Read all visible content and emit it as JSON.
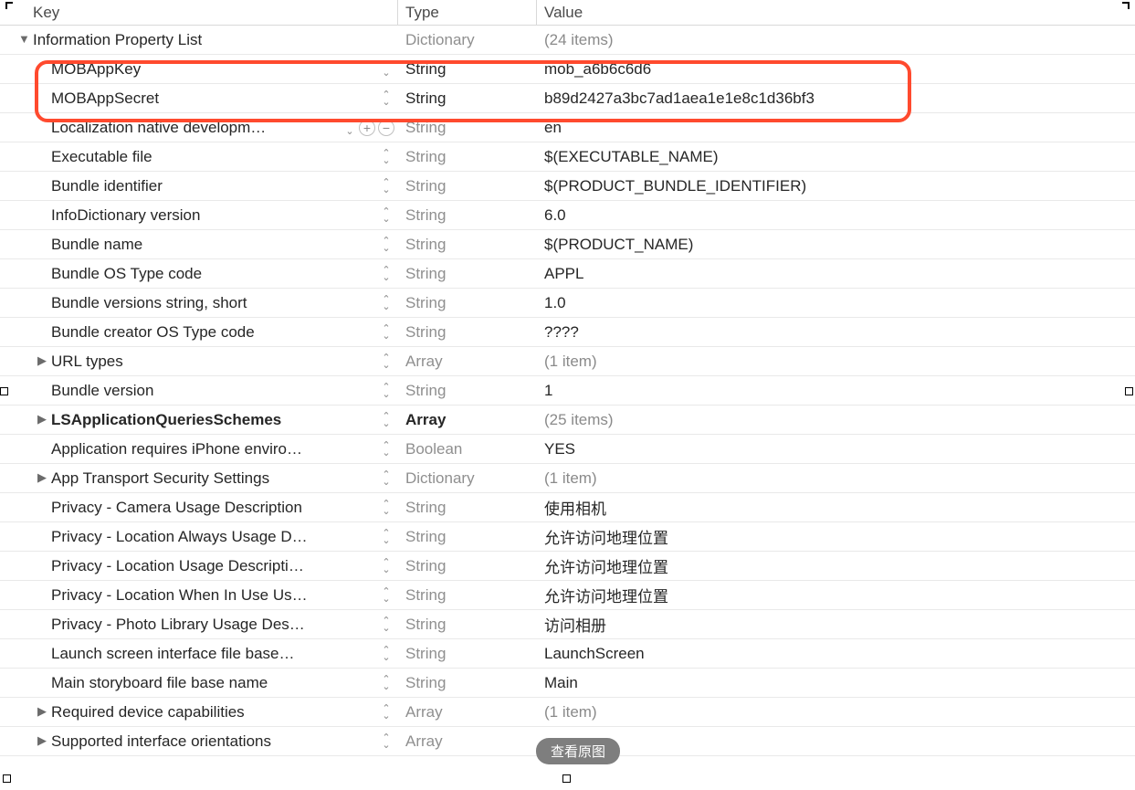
{
  "columns": {
    "key": "Key",
    "type": "Type",
    "value": "Value"
  },
  "root": {
    "key": "Information Property List",
    "type": "Dictionary",
    "value": "(24 items)"
  },
  "rows": [
    {
      "key": "MOBAppKey",
      "type": "String",
      "value": "mob_a6b6c6d6",
      "typeClass": "black",
      "valueClass": "black",
      "stepper": true
    },
    {
      "key": "MOBAppSecret",
      "type": "String",
      "value": "b89d2427a3bc7ad1aea1e1e8c1d36bf3",
      "typeClass": "black",
      "valueClass": "black",
      "stepper": true
    },
    {
      "key": "Localization native developm…",
      "type": "String",
      "value": "en",
      "typeClass": "gray",
      "valueClass": "black",
      "addremove": true
    },
    {
      "key": "Executable file",
      "type": "String",
      "value": "$(EXECUTABLE_NAME)",
      "typeClass": "gray",
      "valueClass": "black",
      "stepper": true
    },
    {
      "key": "Bundle identifier",
      "type": "String",
      "value": "$(PRODUCT_BUNDLE_IDENTIFIER)",
      "typeClass": "gray",
      "valueClass": "black",
      "stepper": true
    },
    {
      "key": "InfoDictionary version",
      "type": "String",
      "value": "6.0",
      "typeClass": "gray",
      "valueClass": "black",
      "stepper": true
    },
    {
      "key": "Bundle name",
      "type": "String",
      "value": "$(PRODUCT_NAME)",
      "typeClass": "gray",
      "valueClass": "black",
      "stepper": true
    },
    {
      "key": "Bundle OS Type code",
      "type": "String",
      "value": "APPL",
      "typeClass": "gray",
      "valueClass": "black",
      "stepper": true
    },
    {
      "key": "Bundle versions string, short",
      "type": "String",
      "value": "1.0",
      "typeClass": "gray",
      "valueClass": "black",
      "stepper": true
    },
    {
      "key": "Bundle creator OS Type code",
      "type": "String",
      "value": "????",
      "typeClass": "gray",
      "valueClass": "black",
      "stepper": true
    },
    {
      "key": "URL types",
      "type": "Array",
      "value": "(1 item)",
      "typeClass": "gray",
      "valueClass": "gray",
      "stepper": true,
      "disclosure": "closed"
    },
    {
      "key": "Bundle version",
      "type": "String",
      "value": "1",
      "typeClass": "gray",
      "valueClass": "black",
      "stepper": true
    },
    {
      "key": "LSApplicationQueriesSchemes",
      "type": "Array",
      "value": "(25 items)",
      "typeClass": "black",
      "valueClass": "gray",
      "stepper": true,
      "disclosure": "closed",
      "bold": true
    },
    {
      "key": "Application requires iPhone enviro…",
      "type": "Boolean",
      "value": "YES",
      "typeClass": "gray",
      "valueClass": "black",
      "stepper": true
    },
    {
      "key": "App Transport Security Settings",
      "type": "Dictionary",
      "value": "(1 item)",
      "typeClass": "gray",
      "valueClass": "gray",
      "stepper": true,
      "disclosure": "closed"
    },
    {
      "key": "Privacy - Camera Usage Description",
      "type": "String",
      "value": "使用相机",
      "typeClass": "gray",
      "valueClass": "black",
      "stepper": true
    },
    {
      "key": "Privacy - Location Always Usage D…",
      "type": "String",
      "value": "允许访问地理位置",
      "typeClass": "gray",
      "valueClass": "black",
      "stepper": true
    },
    {
      "key": "Privacy - Location Usage Descripti…",
      "type": "String",
      "value": "允许访问地理位置",
      "typeClass": "gray",
      "valueClass": "black",
      "stepper": true
    },
    {
      "key": "Privacy - Location When In Use Us…",
      "type": "String",
      "value": "允许访问地理位置",
      "typeClass": "gray",
      "valueClass": "black",
      "stepper": true
    },
    {
      "key": "Privacy - Photo Library Usage Des…",
      "type": "String",
      "value": "访问相册",
      "typeClass": "gray",
      "valueClass": "black",
      "stepper": true
    },
    {
      "key": "Launch screen interface file base…",
      "type": "String",
      "value": "LaunchScreen",
      "typeClass": "gray",
      "valueClass": "black",
      "stepper": true
    },
    {
      "key": "Main storyboard file base name",
      "type": "String",
      "value": "Main",
      "typeClass": "gray",
      "valueClass": "black",
      "stepper": true
    },
    {
      "key": "Required device capabilities",
      "type": "Array",
      "value": "(1 item)",
      "typeClass": "gray",
      "valueClass": "gray",
      "stepper": true,
      "disclosure": "closed"
    },
    {
      "key": "Supported interface orientations",
      "type": "Array",
      "value": "",
      "typeClass": "gray",
      "valueClass": "gray",
      "stepper": true,
      "disclosure": "closed"
    }
  ],
  "overlay_button": "查看原图"
}
